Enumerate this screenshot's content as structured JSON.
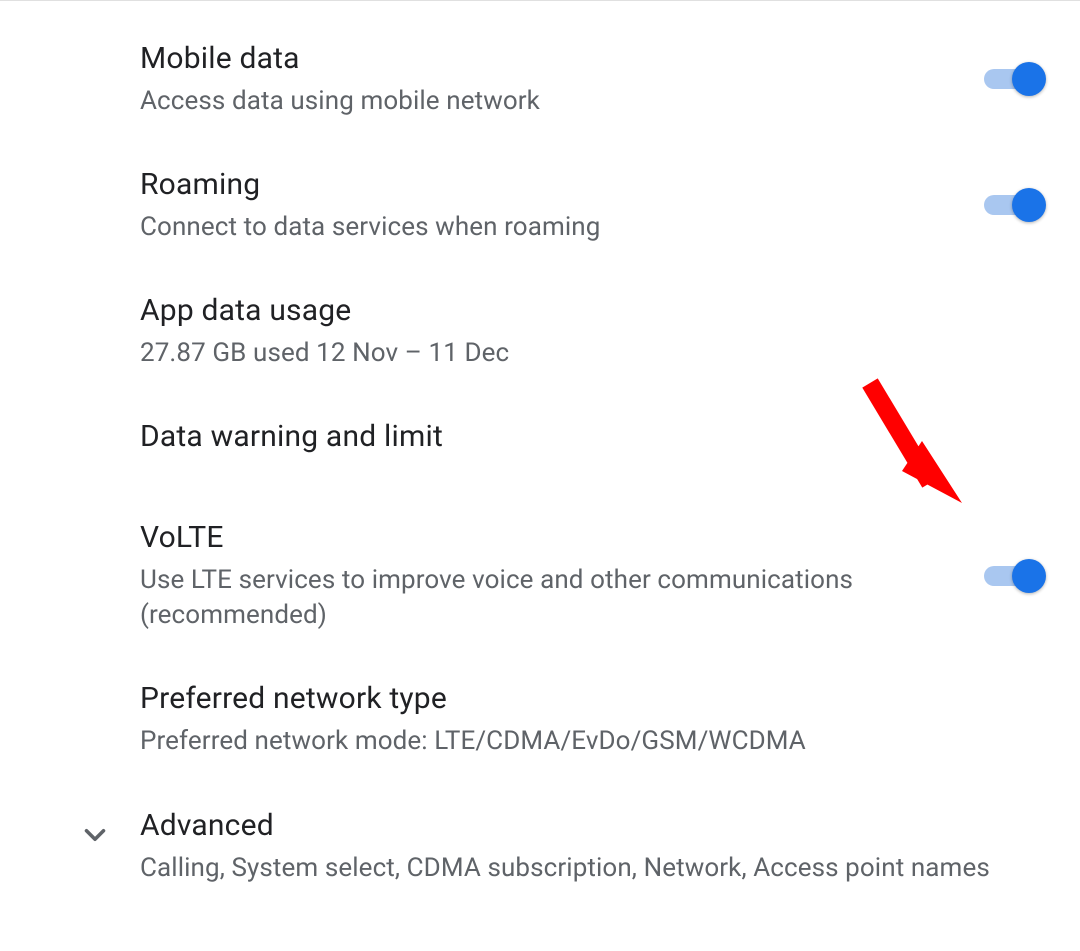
{
  "settings": [
    {
      "key": "mobile_data",
      "title": "Mobile data",
      "subtitle": "Access data using mobile network",
      "toggle": true,
      "toggle_on": true
    },
    {
      "key": "roaming",
      "title": "Roaming",
      "subtitle": "Connect to data services when roaming",
      "toggle": true,
      "toggle_on": true
    },
    {
      "key": "app_data_usage",
      "title": "App data usage",
      "subtitle": "27.87 GB used 12 Nov – 11 Dec",
      "toggle": false
    },
    {
      "key": "data_warning_limit",
      "title": "Data warning and limit",
      "subtitle": "",
      "toggle": false
    },
    {
      "key": "volte",
      "title": "VoLTE",
      "subtitle": "Use LTE services to improve voice and other communications (recommended)",
      "toggle": true,
      "toggle_on": true
    },
    {
      "key": "preferred_network_type",
      "title": "Preferred network type",
      "subtitle": "Preferred network mode: LTE/CDMA/EvDo/GSM/WCDMA",
      "toggle": false
    }
  ],
  "advanced": {
    "title": "Advanced",
    "subtitle": "Calling, System select, CDMA subscription, Network, Access point names"
  },
  "colors": {
    "accent": "#1a73e8",
    "track": "#a9c7f0",
    "text_primary": "#202124",
    "text_secondary": "#5f6368",
    "annotation": "#ff0000"
  }
}
